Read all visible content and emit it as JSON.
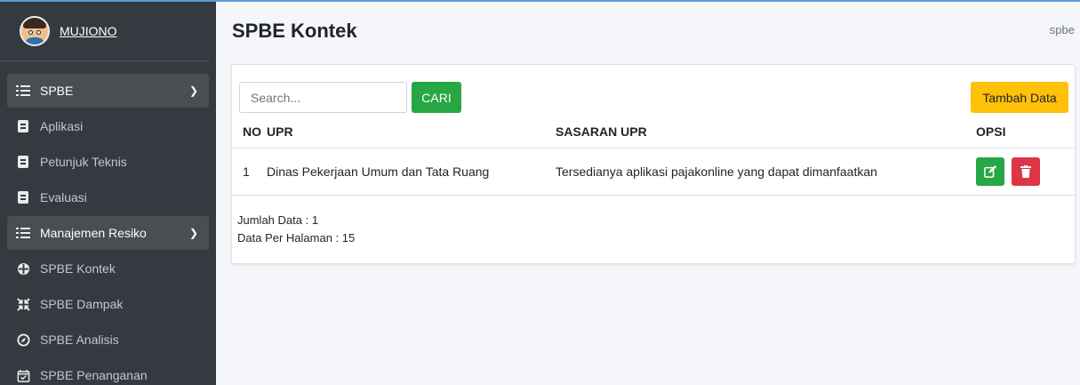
{
  "user": {
    "name": "MUJIONO"
  },
  "sidebar": {
    "items": [
      {
        "label": "SPBE",
        "icon": "list-icon",
        "open": true
      },
      {
        "label": "Aplikasi",
        "icon": "document-icon"
      },
      {
        "label": "Petunjuk Teknis",
        "icon": "document-icon"
      },
      {
        "label": "Evaluasi",
        "icon": "document-icon"
      },
      {
        "label": "Manajemen Resiko",
        "icon": "list-icon",
        "open": true
      },
      {
        "label": "SPBE Kontek",
        "icon": "crosshair-icon"
      },
      {
        "label": "SPBE Dampak",
        "icon": "compress-icon"
      },
      {
        "label": "SPBE Analisis",
        "icon": "compass-icon"
      },
      {
        "label": "SPBE Penanganan",
        "icon": "calendar-check-icon"
      }
    ]
  },
  "header": {
    "title": "SPBE Kontek",
    "breadcrumb": "spbe"
  },
  "search": {
    "placeholder": "Search...",
    "button": "CARI"
  },
  "actions": {
    "add": "Tambah Data"
  },
  "table": {
    "columns": [
      "NO",
      "UPR",
      "SASARAN UPR",
      "OPSI"
    ],
    "rows": [
      {
        "no": "1",
        "upr": "Dinas Pekerjaan Umum dan Tata Ruang",
        "sasaran": "Tersedianya aplikasi pajakonline yang dapat dimanfaatkan"
      }
    ]
  },
  "summary": {
    "count": "Jumlah Data : 1",
    "per_page": "Data Per Halaman : 15"
  },
  "colors": {
    "sidebar": "#343a40",
    "success": "#28a745",
    "warning": "#ffc107",
    "danger": "#dc3545"
  }
}
